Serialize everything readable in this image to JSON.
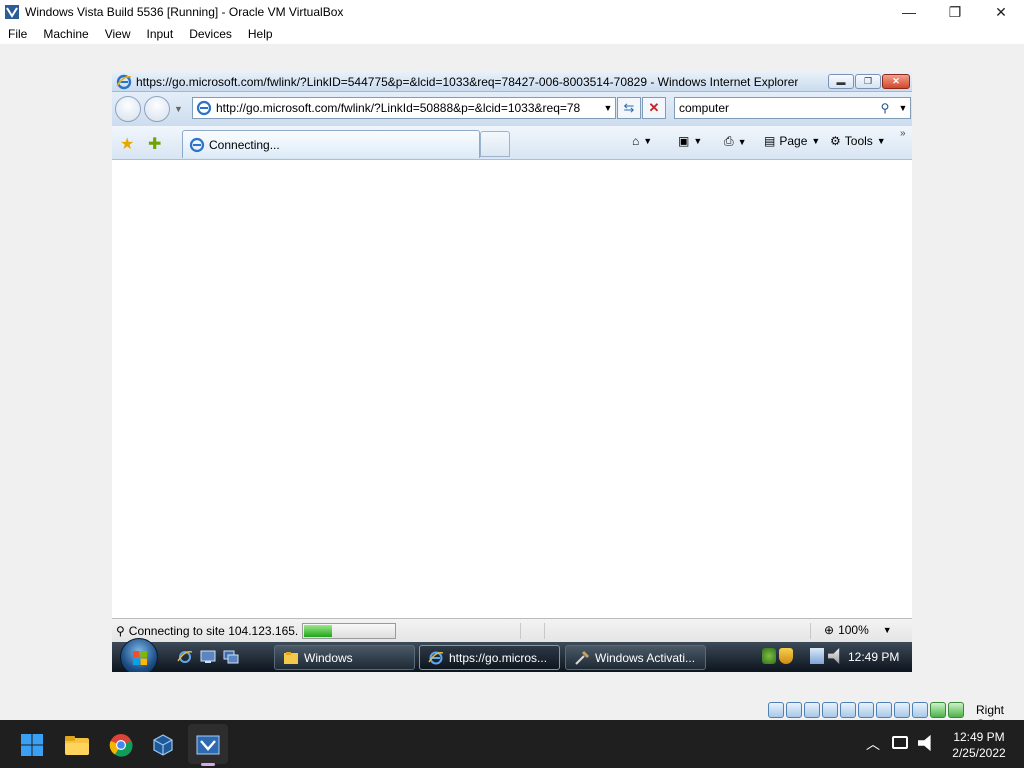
{
  "vbox": {
    "title": "Windows Vista Build 5536 [Running] - Oracle VM VirtualBox",
    "menu": [
      "File",
      "Machine",
      "View",
      "Input",
      "Devices",
      "Help"
    ],
    "window_controls": {
      "minimize": "—",
      "maximize": "❐",
      "close": "✕"
    },
    "host_key": "Right Ctrl"
  },
  "ie": {
    "window_title": "https://go.microsoft.com/fwlink/?LinkID=544775&p=&lcid=1033&req=78427-006-8003514-70829 - Windows Internet Explorer",
    "address": "http://go.microsoft.com/fwlink/?LinkId=50888&p=&lcid=1033&req=78",
    "search_value": "computer",
    "tab_label": "Connecting...",
    "page_label": "Page",
    "tools_label": "Tools",
    "status_text": "Connecting to site 104.123.165.",
    "progress_fraction": 0.3,
    "zoom": "100%"
  },
  "vista_taskbar": {
    "buttons": [
      {
        "label": "Windows"
      },
      {
        "label": "https://go.micros..."
      },
      {
        "label": "Windows Activati..."
      }
    ],
    "clock": "12:49 PM"
  },
  "host_taskbar": {
    "time": "12:49 PM",
    "date": "2/25/2022",
    "icons": [
      "windows-start-icon",
      "file-explorer-icon",
      "chrome-icon",
      "virtualbox-icon",
      "vista-vm-icon"
    ]
  },
  "colors": {
    "ie_frame": "#cddcee",
    "vista_taskbar": "#0d151e",
    "host_taskbar": "#1f1f1f",
    "progress": "#1fa51a"
  }
}
